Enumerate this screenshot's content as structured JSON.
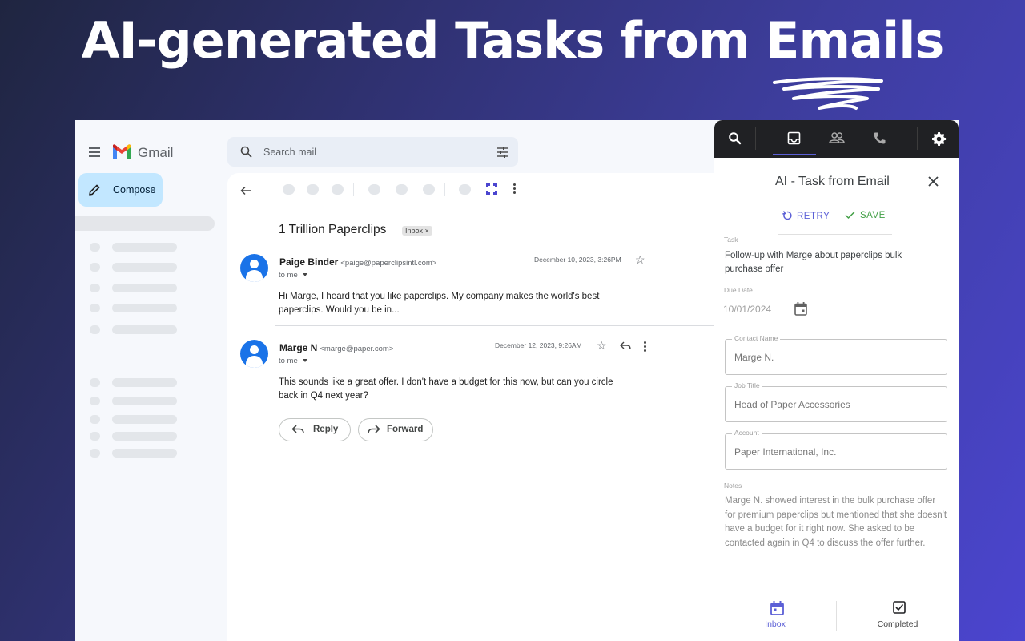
{
  "headline": "AI-generated Tasks from Emails",
  "gmail": {
    "brand": "Gmail",
    "compose_label": "Compose",
    "search_placeholder": "Search mail",
    "thread": {
      "subject": "1 Trillion Paperclips",
      "label_badge": "Inbox ×",
      "messages": [
        {
          "sender": "Paige Binder",
          "email": "<paige@paperclipsintl.com>",
          "to": "to me",
          "date": "December 10, 2023, 3:26PM",
          "body": "Hi Marge, I heard that you like paperclips. My company makes the world's best paperclips. Would you be in..."
        },
        {
          "sender": "Marge N",
          "email": "<marge@paper.com>",
          "to": "to me",
          "date": "December 12, 2023, 9:26AM",
          "body": "This sounds like a great offer. I don't have a budget for this now, but can you circle back in Q4 next year?"
        }
      ],
      "reply_label": "Reply",
      "forward_label": "Forward"
    }
  },
  "panel": {
    "title": "AI - Task from Email",
    "retry_label": "RETRY",
    "save_label": "SAVE",
    "task_label": "Task",
    "task_value": "Follow-up with Marge about paperclips bulk purchase offer",
    "due_date_label": "Due Date",
    "due_date_value": "10/01/2024",
    "contact_name_label": "Contact Name",
    "contact_name_value": "Marge N.",
    "job_title_label": "Job Title",
    "job_title_value": "Head of Paper Accessories",
    "account_label": "Account",
    "account_value": "Paper International, Inc.",
    "notes_label": "Notes",
    "notes_value": "Marge N. showed interest in the bulk purchase offer for premium paperclips but mentioned that she doesn't have a budget for it right now. She asked to be contacted again in Q4 to discuss the offer further.",
    "bottom_tabs": [
      {
        "label": "Inbox",
        "active": true
      },
      {
        "label": "Completed",
        "active": false
      }
    ],
    "accent_color": "#5b5fd6",
    "save_color": "#43a047"
  }
}
